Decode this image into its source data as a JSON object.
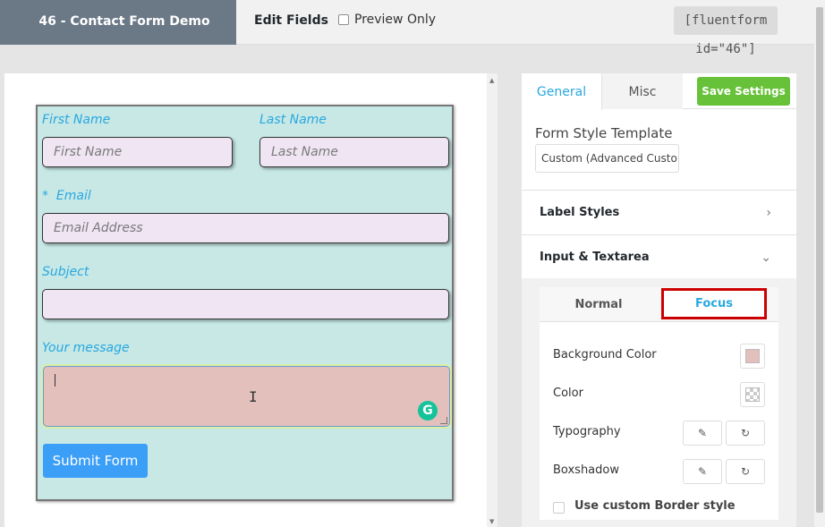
{
  "header": {
    "form_title": "46 - Contact Form Demo",
    "edit_fields": "Edit Fields",
    "preview_only": "Preview Only",
    "shortcode": "[fluentform id=\"46\"]"
  },
  "form": {
    "first_name": {
      "label": "First Name",
      "placeholder": "First Name"
    },
    "last_name": {
      "label": "Last Name",
      "placeholder": "Last Name"
    },
    "email": {
      "required_mark": "*",
      "label": "Email",
      "placeholder": "Email Address"
    },
    "subject": {
      "label": "Subject",
      "placeholder": ""
    },
    "message": {
      "label": "Your message"
    },
    "submit_label": "Submit Form"
  },
  "settings": {
    "tabs": {
      "general": "General",
      "misc": "Misc"
    },
    "save_label": "Save Settings",
    "form_style_template": {
      "label": "Form Style Template",
      "value": "Custom (Advanced Custom"
    },
    "label_styles": "Label Styles",
    "input_textarea": "Input & Textarea",
    "state_tabs": {
      "normal": "Normal",
      "focus": "Focus"
    },
    "rows": {
      "background_color": "Background Color",
      "color": "Color",
      "typography": "Typography",
      "boxshadow": "Boxshadow"
    },
    "custom_border": "Use custom Border style"
  },
  "colors": {
    "form_bg": "#c7e8e5",
    "label": "#29a8e0",
    "input_bg": "#efe5f3",
    "textarea_focus_bg": "#e3c0bc",
    "submit_bg": "#3c9ff7",
    "save_bg": "#67c23a",
    "highlight": "#cc0000",
    "swatch_bg": "#e3c0bc"
  },
  "icons": {
    "chevron_right": "chevron-right-icon",
    "chevron_down": "chevron-down-icon",
    "edit": "pencil-icon",
    "reset": "refresh-icon",
    "grammarly": "grammarly-icon"
  }
}
